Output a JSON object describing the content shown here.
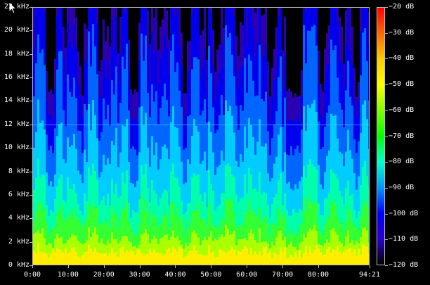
{
  "y_axis": {
    "labels": [
      "0 kHz",
      "2 kHz",
      "4 kHz",
      "6 kHz",
      "8 kHz",
      "10 kHz",
      "12 kHz",
      "14 kHz",
      "16 kHz",
      "18 kHz",
      "20 kHz",
      "22 kHz"
    ],
    "min_khz": 0,
    "max_khz": 22
  },
  "x_axis": {
    "labels": [
      "0:00",
      "10:00",
      "20:00",
      "30:00",
      "40:00",
      "50:00",
      "60:00",
      "70:00",
      "80:00",
      "94:21"
    ],
    "positions_min": [
      0,
      10,
      20,
      30,
      40,
      50,
      60,
      70,
      80,
      94.35
    ],
    "max_min": 94.35
  },
  "colorbar": {
    "labels": [
      "−20 dB",
      "−30 dB",
      "−40 dB",
      "−50 dB",
      "−60 dB",
      "−70 dB",
      "−80 dB",
      "−90 dB",
      "−100 dB",
      "−110 dB",
      "−120 dB"
    ],
    "max_db": -20,
    "min_db": -120,
    "stops": [
      "#ff0000",
      "#ff6600",
      "#ffcc00",
      "#ffff00",
      "#7fff00",
      "#00ff00",
      "#00ffcc",
      "#0099ff",
      "#0000ff",
      "#2a00cc",
      "#000000"
    ]
  },
  "spectrogram": {
    "band_colors": [
      "#ffee00",
      "#aaff00",
      "#33ff33",
      "#00ffaa",
      "#00ccff",
      "#0066ff",
      "#0000ee",
      "#2a00b0"
    ],
    "band_fractions": [
      0.03,
      0.08,
      0.16,
      0.26,
      0.42,
      0.62,
      0.8,
      0.95
    ]
  },
  "cursor_icon": "mouse-pointer-icon"
}
